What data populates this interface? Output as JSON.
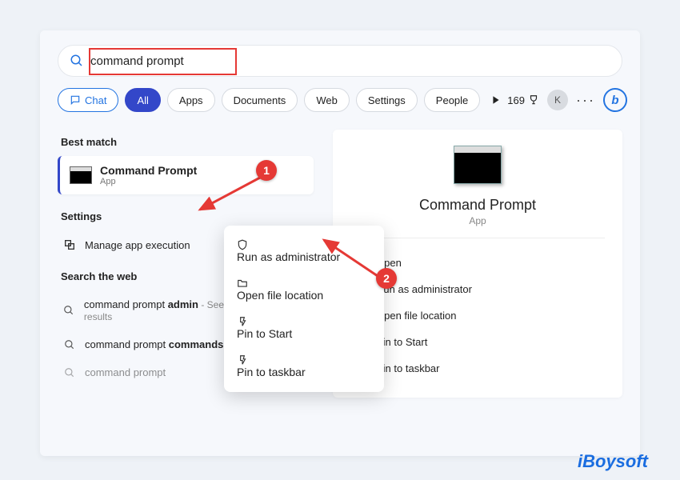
{
  "search": {
    "value": "command prompt"
  },
  "filters": {
    "chat": "Chat",
    "all": "All",
    "apps": "Apps",
    "documents": "Documents",
    "web": "Web",
    "settings": "Settings",
    "people": "People"
  },
  "header_right": {
    "points": "169",
    "avatar_initial": "K"
  },
  "left": {
    "best_match_header": "Best match",
    "best_match": {
      "title": "Command Prompt",
      "subtitle": "App"
    },
    "settings_header": "Settings",
    "settings_item": "Manage app execution",
    "web_header": "Search the web",
    "web_items": [
      {
        "prefix": "command prompt ",
        "bold": "admin",
        "suffix": " - See more search results"
      },
      {
        "prefix": "command prompt ",
        "bold": "commands",
        "suffix": ""
      },
      {
        "prefix": "command prompt",
        "bold": "",
        "suffix": ""
      }
    ]
  },
  "context_menu": {
    "run_admin": "Run as administrator",
    "open_loc": "Open file location",
    "pin_start": "Pin to Start",
    "pin_taskbar": "Pin to taskbar"
  },
  "right": {
    "title": "Command Prompt",
    "subtitle": "App",
    "open": "Open",
    "run_admin": "Run as administrator",
    "open_loc": "Open file location",
    "pin_start": "Pin to Start",
    "pin_taskbar": "Pin to taskbar"
  },
  "annotations": {
    "badge1": "1",
    "badge2": "2"
  },
  "watermark": "iBoysoft"
}
